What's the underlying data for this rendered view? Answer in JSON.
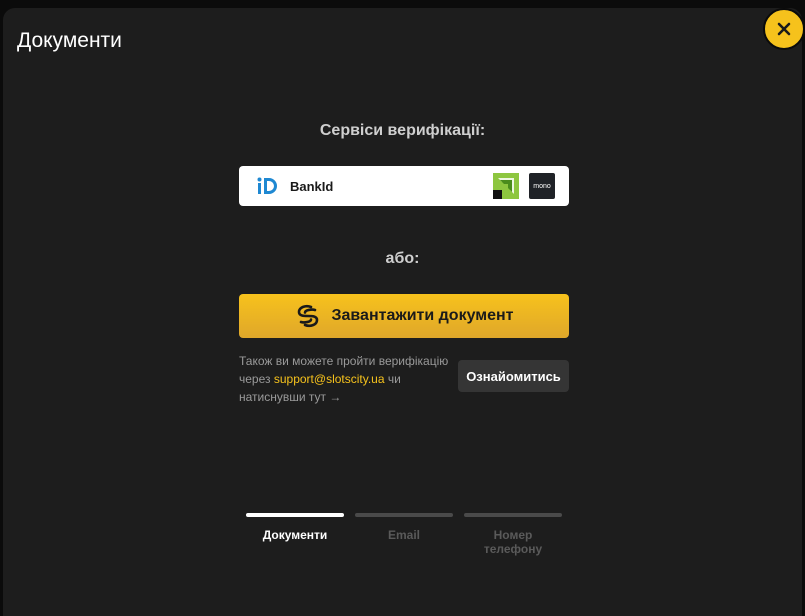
{
  "modal": {
    "title": "Документи",
    "close_icon": "close-icon"
  },
  "verification": {
    "title": "Сервіси верифікації:",
    "bankid_label": "BankId",
    "icons": [
      "bankid-icon",
      "privatbank-icon",
      "monobank-icon"
    ],
    "mono_text": "mono"
  },
  "or_text": "або:",
  "upload": {
    "label": "Завантажити документ",
    "icon": "sumsub-icon"
  },
  "info": {
    "line1": "Також ви можете пройти верифікацію через ",
    "email": "support@slotscity.ua",
    "line2": " чи натиснувши тут →",
    "button_label": "Ознайомитись"
  },
  "steps": [
    {
      "label": "Документи",
      "active": true
    },
    {
      "label": "Email",
      "active": false
    },
    {
      "label": "Номер телефону",
      "active": false
    }
  ],
  "colors": {
    "accent": "#f6c21c",
    "background": "#1d1d1d",
    "privatbank_green": "#8dc63f"
  }
}
